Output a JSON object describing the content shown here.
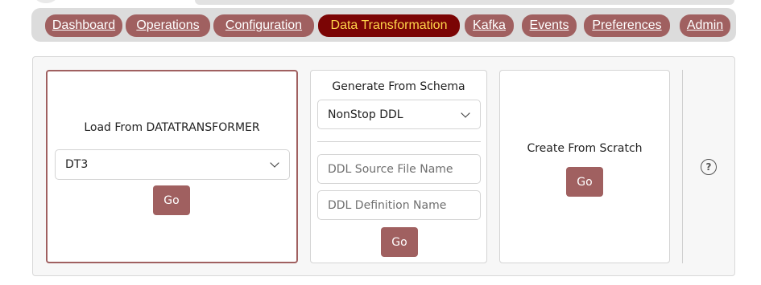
{
  "nav": {
    "tabs": [
      {
        "label": "Dashboard",
        "active": false
      },
      {
        "label": "Operations",
        "active": false
      },
      {
        "label": "Configuration",
        "active": false
      },
      {
        "label": "Data Transformation",
        "active": true
      },
      {
        "label": "Kafka",
        "active": false
      },
      {
        "label": "Events",
        "active": false
      },
      {
        "label": "Preferences",
        "active": false
      },
      {
        "label": "Admin",
        "active": false
      }
    ]
  },
  "load_card": {
    "title": "Load From DATATRANSFORMER",
    "select_value": "DT3",
    "go_label": "Go"
  },
  "schema_card": {
    "title": "Generate From Schema",
    "select_value": "NonStop DDL",
    "source_placeholder": "DDL Source File Name",
    "definition_placeholder": "DDL Definition Name",
    "go_label": "Go"
  },
  "scratch_card": {
    "title": "Create From Scratch",
    "go_label": "Go"
  },
  "help": {
    "icon": "help-circle-icon",
    "glyph": "?"
  },
  "colors": {
    "tab": "#a06060",
    "tab_active": "#7b0505",
    "tab_active_text": "#ffd54a",
    "button": "#a06060"
  }
}
